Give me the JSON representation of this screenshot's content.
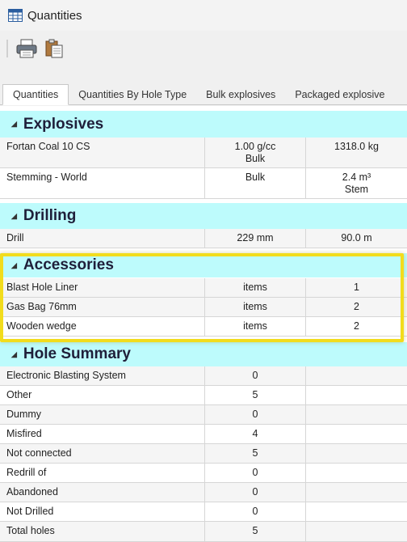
{
  "window": {
    "title": "Quantities"
  },
  "toolbar": {
    "print_icon": "printer-icon",
    "paste_icon": "clipboard-icon"
  },
  "tabs": [
    {
      "label": "Quantities",
      "active": true
    },
    {
      "label": "Quantities By Hole Type"
    },
    {
      "label": "Bulk explosives"
    },
    {
      "label": "Packaged explosive"
    }
  ],
  "groups": {
    "explosives": {
      "title": "Explosives",
      "rows": [
        {
          "name": "Fortan Coal 10 CS",
          "col2": [
            "1.00 g/cc",
            "Bulk"
          ],
          "col3": [
            "1318.0 kg"
          ]
        },
        {
          "name": "Stemming - World",
          "col2": [
            "Bulk"
          ],
          "col3": [
            "2.4 m³",
            "Stem"
          ]
        }
      ]
    },
    "drilling": {
      "title": "Drilling",
      "rows": [
        {
          "name": "Drill",
          "col2": "229 mm",
          "col3": "90.0 m"
        }
      ]
    },
    "accessories": {
      "title": "Accessories",
      "rows": [
        {
          "name": "Blast Hole Liner",
          "col2": "items",
          "col3": "1"
        },
        {
          "name": "Gas Bag 76mm",
          "col2": "items",
          "col3": "2"
        },
        {
          "name": "Wooden wedge",
          "col2": "items",
          "col3": "2"
        }
      ]
    },
    "hole_summary": {
      "title": "Hole Summary",
      "rows": [
        {
          "name": "Electronic Blasting System",
          "col2": "0",
          "col3": ""
        },
        {
          "name": "Other",
          "col2": "5",
          "col3": ""
        },
        {
          "name": "Dummy",
          "col2": "0",
          "col3": ""
        },
        {
          "name": "Misfired",
          "col2": "4",
          "col3": ""
        },
        {
          "name": "Not connected",
          "col2": "5",
          "col3": ""
        },
        {
          "name": "Redrill of",
          "col2": "0",
          "col3": ""
        },
        {
          "name": "Abandoned",
          "col2": "0",
          "col3": ""
        },
        {
          "name": "Not Drilled",
          "col2": "0",
          "col3": ""
        },
        {
          "name": "Total holes",
          "col2": "5",
          "col3": ""
        }
      ]
    }
  },
  "colors": {
    "group_header_bg": "#bdfbfc",
    "highlight_border": "#f2dc1c"
  }
}
